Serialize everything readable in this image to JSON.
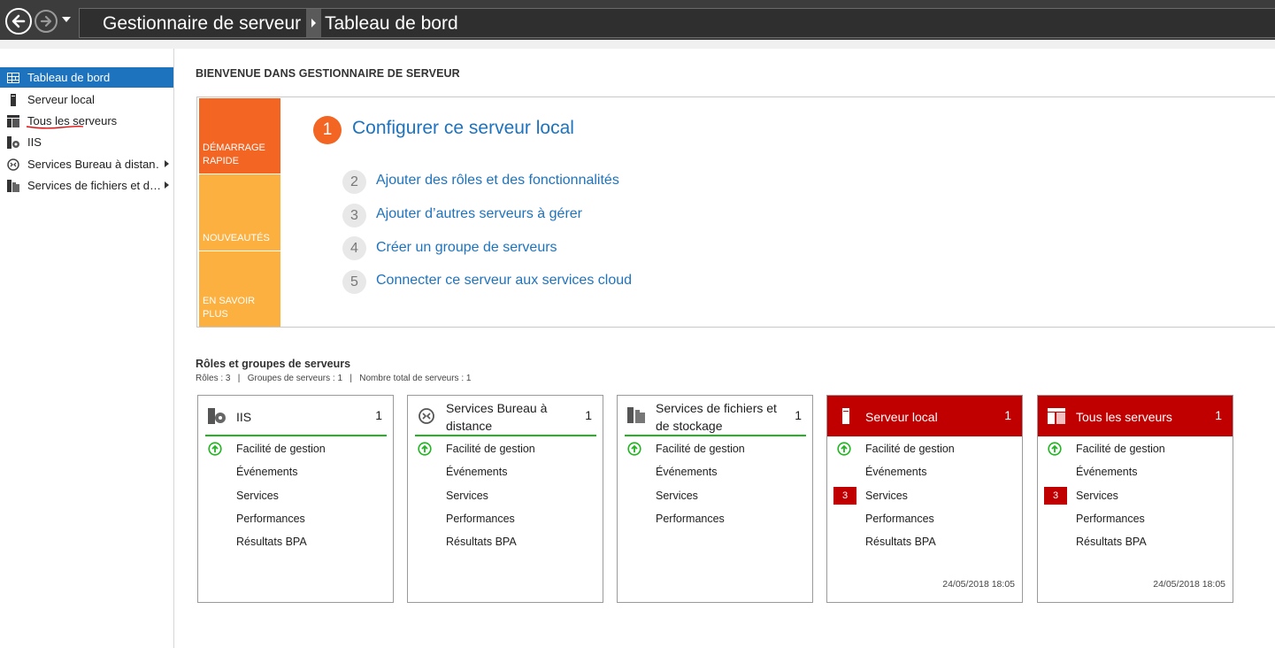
{
  "titlebar": {
    "breadcrumb_root": "Gestionnaire de serveur",
    "breadcrumb_page": "Tableau de bord"
  },
  "sidebar": {
    "items": [
      {
        "label": "Tableau de bord",
        "icon": "dashboard-icon",
        "active": true
      },
      {
        "label": "Serveur local",
        "icon": "server-icon"
      },
      {
        "label": "Tous les serveurs",
        "icon": "servers-icon"
      },
      {
        "label": "IIS",
        "icon": "iis-icon"
      },
      {
        "label": "Services Bureau à distan…",
        "icon": "remote-desktop-icon",
        "expandable": true
      },
      {
        "label": "Services de fichiers et d…",
        "icon": "file-services-icon",
        "expandable": true
      }
    ]
  },
  "welcome": {
    "title": "BIENVENUE DANS GESTIONNAIRE DE SERVEUR",
    "tiles": [
      "DÉMARRAGE RAPIDE",
      "NOUVEAUTÉS",
      "EN SAVOIR PLUS"
    ],
    "primary_step": {
      "number": "1",
      "label": "Configurer ce serveur local"
    },
    "steps": [
      {
        "number": "2",
        "label": "Ajouter des rôles et des fonctionnalités"
      },
      {
        "number": "3",
        "label": "Ajouter d’autres serveurs à gérer"
      },
      {
        "number": "4",
        "label": "Créer un groupe de serveurs"
      },
      {
        "number": "5",
        "label": "Connecter ce serveur aux services cloud"
      }
    ]
  },
  "roles": {
    "title": "Rôles et groupes de serveurs",
    "summary": "Rôles : 3   |   Groupes de serveurs : 1   |   Nombre total de serveurs : 1",
    "cards": [
      {
        "title": "IIS",
        "count": "1",
        "icon": "iis-icon",
        "status": "ok",
        "rows": [
          "Facilité de gestion",
          "Événements",
          "Services",
          "Performances",
          "Résultats BPA"
        ]
      },
      {
        "title": "Services Bureau à distance",
        "count": "1",
        "icon": "remote-desktop-icon",
        "status": "ok",
        "rows": [
          "Facilité de gestion",
          "Événements",
          "Services",
          "Performances",
          "Résultats BPA"
        ]
      },
      {
        "title": "Services de fichiers et de stockage",
        "count": "1",
        "icon": "file-services-icon",
        "status": "ok",
        "rows": [
          "Facilité de gestion",
          "Événements",
          "Services",
          "Performances"
        ]
      },
      {
        "title": "Serveur local",
        "count": "1",
        "icon": "server-icon",
        "status": "alert",
        "rows": [
          "Facilité de gestion",
          "Événements",
          "Services",
          "Performances",
          "Résultats BPA"
        ],
        "services_badge": "3",
        "timestamp": "24/05/2018 18:05"
      },
      {
        "title": "Tous les serveurs",
        "count": "1",
        "icon": "servers-icon",
        "status": "alert",
        "rows": [
          "Facilité de gestion",
          "Événements",
          "Services",
          "Performances",
          "Résultats BPA"
        ],
        "services_badge": "3",
        "timestamp": "24/05/2018 18:05"
      }
    ]
  },
  "colors": {
    "accent": "#1e73be",
    "quickstart": "#f26522",
    "tile": "#fbb040",
    "alert": "#c00000",
    "ok": "#22b522"
  }
}
